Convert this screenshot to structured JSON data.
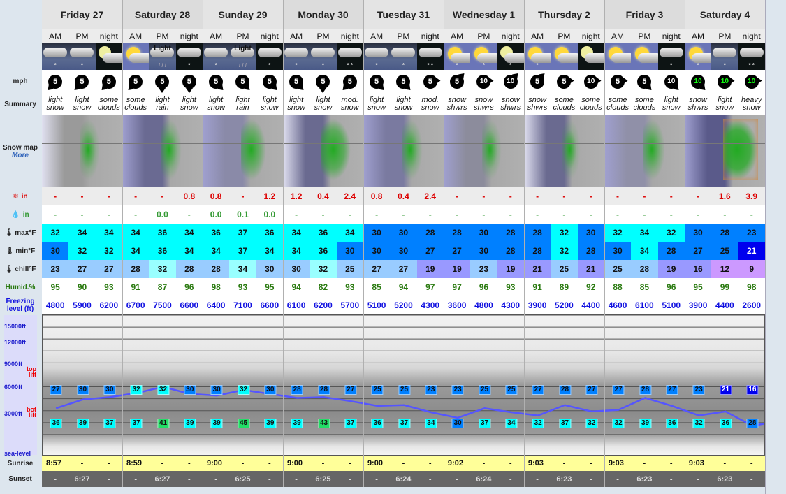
{
  "labels": {
    "wind": "mph",
    "summary": "Summary",
    "snowmap": "Snow map",
    "snowmap_more": "More",
    "snow": "in",
    "rain": "in",
    "max": "max°F",
    "min": "min°F",
    "chill": "chill°F",
    "humid": "Humid.%",
    "freezing": "Freezing level (ft)",
    "alt_15000": "15000ft",
    "alt_12000": "12000ft",
    "alt_9000": "9000ft",
    "alt_6000": "6000ft",
    "alt_3000": "3000ft",
    "alt_sea": "sea-level",
    "top_lift": "top lift",
    "bot_lift": "bot lift",
    "sunrise": "Sunrise",
    "sunset": "Sunset"
  },
  "days": [
    "Friday 27",
    "Saturday 28",
    "Sunday 29",
    "Monday 30",
    "Tuesday 31",
    "Wednesday 1",
    "Thursday 2",
    "Friday 3",
    "Saturday 4"
  ],
  "periods": [
    "AM",
    "PM",
    "night"
  ],
  "weather_icons": [
    "cloud-snow-icon",
    "cloud-snow-icon",
    "moon-cloud-icon",
    "sun-cloud-icon",
    "light-rain-icon",
    "night-cloud-snow-icon",
    "cloud-snow-icon",
    "light-rain-icon",
    "night-cloud-snow-icon",
    "cloud-snow-icon",
    "cloud-snow-icon",
    "night-heavy-snow-icon",
    "cloud-snow-icon",
    "cloud-snow-icon",
    "night-heavy-snow-icon",
    "sun-cloud-snow-icon",
    "sun-cloud-snow-icon",
    "moon-cloud-snow-icon",
    "sun-cloud-snow-icon",
    "sun-cloud-icon",
    "moon-cloud-icon",
    "sun-cloud-icon",
    "sun-cloud-icon",
    "night-cloud-snow-icon",
    "sun-cloud-snow-icon",
    "cloud-snow-icon",
    "night-heavy-snow-icon"
  ],
  "weather_icon_text": [
    "",
    "",
    "",
    "",
    "Light",
    "",
    "",
    "Light",
    "",
    "",
    "",
    "",
    "",
    "",
    "",
    "",
    "",
    "",
    "",
    "",
    "",
    "",
    "",
    "",
    "",
    "",
    ""
  ],
  "wind": {
    "speeds": [
      5,
      5,
      5,
      5,
      5,
      5,
      5,
      5,
      5,
      5,
      5,
      5,
      5,
      5,
      5,
      5,
      10,
      10,
      5,
      5,
      10,
      5,
      5,
      10,
      10,
      10,
      10
    ],
    "directions": [
      "SW",
      "SW",
      "SW",
      "SW",
      "S",
      "S",
      "SE",
      "SE",
      "SE",
      "SE",
      "S",
      "SW",
      "SE",
      "SE",
      "E",
      "NE",
      "E",
      "NE",
      "NE",
      "E",
      "E",
      "E",
      "SE",
      "SE",
      "SE",
      "E",
      "E"
    ],
    "colors": [
      "#000",
      "#000",
      "#000",
      "#000",
      "#000",
      "#000",
      "#000",
      "#000",
      "#000",
      "#000",
      "#000",
      "#000",
      "#000",
      "#000",
      "#000",
      "#000",
      "#000",
      "#000",
      "#000",
      "#000",
      "#000",
      "#000",
      "#000",
      "#000",
      "#000",
      "#000",
      "#000"
    ],
    "text_colors": [
      "#fff",
      "#fff",
      "#fff",
      "#fff",
      "#fff",
      "#fff",
      "#fff",
      "#fff",
      "#fff",
      "#fff",
      "#fff",
      "#fff",
      "#fff",
      "#fff",
      "#fff",
      "#fff",
      "#fff",
      "#fff",
      "#fff",
      "#fff",
      "#fff",
      "#fff",
      "#fff",
      "#fff",
      "#1f1",
      "#1f1",
      "#1f1"
    ]
  },
  "summary": [
    [
      "light",
      "snow"
    ],
    [
      "light",
      "snow"
    ],
    [
      "some",
      "clouds"
    ],
    [
      "some",
      "clouds"
    ],
    [
      "light",
      "rain"
    ],
    [
      "light",
      "snow"
    ],
    [
      "light",
      "snow"
    ],
    [
      "light",
      "rain"
    ],
    [
      "light",
      "snow"
    ],
    [
      "light",
      "snow"
    ],
    [
      "light",
      "snow"
    ],
    [
      "mod.",
      "snow"
    ],
    [
      "light",
      "snow"
    ],
    [
      "light",
      "snow"
    ],
    [
      "mod.",
      "snow"
    ],
    [
      "snow",
      "shwrs"
    ],
    [
      "snow",
      "shwrs"
    ],
    [
      "snow",
      "shwrs"
    ],
    [
      "snow",
      "shwrs"
    ],
    [
      "some",
      "clouds"
    ],
    [
      "some",
      "clouds"
    ],
    [
      "some",
      "clouds"
    ],
    [
      "some",
      "clouds"
    ],
    [
      "light",
      "snow"
    ],
    [
      "snow",
      "shwrs"
    ],
    [
      "light",
      "snow"
    ],
    [
      "heavy",
      "snow"
    ]
  ],
  "snow_in": [
    "-",
    "-",
    "-",
    "-",
    "-",
    "0.8",
    "0.8",
    "-",
    "1.2",
    "1.2",
    "0.4",
    "2.4",
    "0.8",
    "0.4",
    "2.4",
    "-",
    "-",
    "-",
    "-",
    "-",
    "-",
    "-",
    "-",
    "-",
    "-",
    "1.6",
    "3.9"
  ],
  "rain_in": [
    "-",
    "-",
    "-",
    "-",
    "0.0",
    "-",
    "0.0",
    "0.1",
    "0.0",
    "-",
    "-",
    "-",
    "-",
    "-",
    "-",
    "-",
    "-",
    "-",
    "-",
    "-",
    "-",
    "-",
    "-",
    "-",
    "-",
    "-",
    "-"
  ],
  "max_f": [
    32,
    34,
    34,
    34,
    36,
    34,
    36,
    37,
    36,
    34,
    36,
    34,
    30,
    30,
    28,
    28,
    30,
    28,
    28,
    32,
    30,
    32,
    34,
    32,
    30,
    28,
    23
  ],
  "min_f": [
    30,
    32,
    32,
    34,
    36,
    34,
    34,
    37,
    34,
    34,
    36,
    30,
    30,
    30,
    27,
    27,
    30,
    28,
    28,
    32,
    28,
    30,
    34,
    28,
    27,
    25,
    21
  ],
  "chill_f": [
    23,
    27,
    27,
    28,
    32,
    28,
    28,
    34,
    30,
    30,
    32,
    25,
    27,
    27,
    19,
    19,
    23,
    19,
    21,
    25,
    21,
    25,
    28,
    19,
    16,
    12,
    9
  ],
  "humidity": [
    95,
    90,
    93,
    91,
    87,
    96,
    98,
    93,
    95,
    94,
    82,
    93,
    85,
    94,
    97,
    97,
    96,
    93,
    91,
    89,
    92,
    88,
    85,
    96,
    95,
    99,
    98
  ],
  "freezing_level": [
    4800,
    5900,
    6200,
    6700,
    7500,
    6600,
    6400,
    7100,
    6600,
    6100,
    6200,
    5700,
    5100,
    5200,
    4300,
    3600,
    4800,
    4300,
    3900,
    5200,
    4400,
    4600,
    6100,
    5100,
    3900,
    4400,
    2600
  ],
  "top_lift_temp": [
    27,
    30,
    30,
    32,
    32,
    30,
    30,
    32,
    30,
    28,
    28,
    27,
    25,
    25,
    23,
    23,
    25,
    25,
    27,
    28,
    27,
    27,
    28,
    27,
    23,
    21,
    16
  ],
  "bot_lift_temp": [
    36,
    39,
    37,
    37,
    41,
    39,
    39,
    45,
    39,
    39,
    43,
    37,
    36,
    37,
    34,
    30,
    37,
    34,
    32,
    37,
    32,
    32,
    39,
    36,
    32,
    36,
    28
  ],
  "sunrise": [
    "8:57",
    "-",
    "-",
    "8:59",
    "-",
    "-",
    "9:00",
    "-",
    "-",
    "9:00",
    "-",
    "-",
    "9:00",
    "-",
    "-",
    "9:02",
    "-",
    "-",
    "9:03",
    "-",
    "-",
    "9:03",
    "-",
    "-",
    "9:03",
    "-",
    "-"
  ],
  "sunset": [
    "-",
    "6:27",
    "-",
    "-",
    "6:27",
    "-",
    "-",
    "6:25",
    "-",
    "-",
    "6:25",
    "-",
    "-",
    "6:24",
    "-",
    "-",
    "6:24",
    "-",
    "-",
    "6:23",
    "-",
    "-",
    "6:23",
    "-",
    "-",
    "6:23",
    "-"
  ],
  "temp_colors": {
    "9": "#cc99ff",
    "12": "#cc99ff",
    "16": "#9999ff",
    "19": "#9999ff",
    "21": "#9999ff",
    "cold_min": "#0000ee",
    "blue": "#0080ff",
    "cyan": "#00ffff",
    "chill_light": "#99ccff",
    "chill_pale": "#99ffff",
    "chill_violet": "#9999ff",
    "chill_lilac": "#cc99ff"
  },
  "chart_altitude": {
    "y_max_ft": 16500,
    "top_lift_ft": 7200,
    "bot_lift_ft": 3000
  }
}
